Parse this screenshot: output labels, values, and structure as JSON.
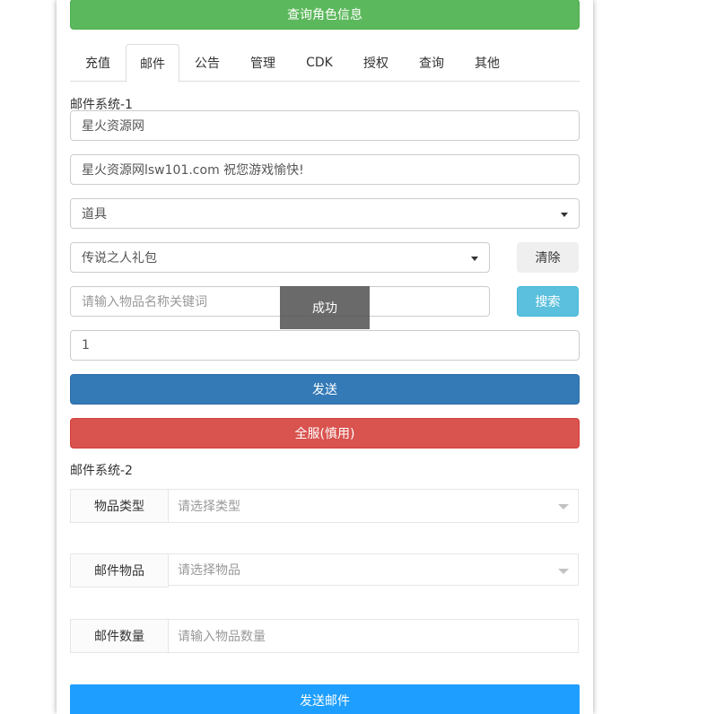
{
  "header": {
    "query_role_label": "查询角色信息"
  },
  "tabs": [
    {
      "label": "充值",
      "active": false
    },
    {
      "label": "邮件",
      "active": true
    },
    {
      "label": "公告",
      "active": false
    },
    {
      "label": "管理",
      "active": false
    },
    {
      "label": "CDK",
      "active": false
    },
    {
      "label": "授权",
      "active": false
    },
    {
      "label": "查询",
      "active": false
    },
    {
      "label": "其他",
      "active": false
    }
  ],
  "mail1": {
    "title": "邮件系统-1",
    "sender_value": "星火资源网",
    "content_value": "星火资源网lsw101.com 祝您游戏愉快!",
    "category_selected": "道具",
    "item_selected": "传说之人礼包",
    "clear_label": "清除",
    "search_placeholder": "请输入物品名称关键词",
    "search_label": "搜索",
    "quantity_value": "1",
    "send_label": "发送",
    "send_all_label": "全服(慎用)"
  },
  "toast": {
    "text": "成功"
  },
  "mail2": {
    "title": "邮件系统-2",
    "type_label": "物品类型",
    "type_placeholder": "请选择类型",
    "item_label": "邮件物品",
    "item_placeholder": "请选择物品",
    "qty_label": "邮件数量",
    "qty_placeholder": "请输入物品数量",
    "send_label": "发送邮件"
  },
  "colors": {
    "success": "#5cb85c",
    "primary": "#337ab7",
    "danger": "#d9534f",
    "info": "#5bc0de",
    "layui_blue": "#1e9fff"
  }
}
